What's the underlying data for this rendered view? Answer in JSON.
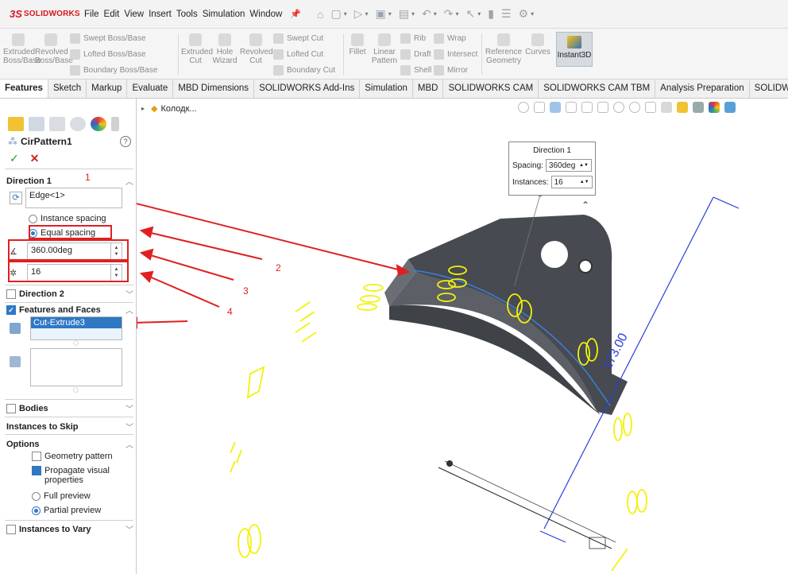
{
  "app": {
    "logo_mark": "3S",
    "logo_text": "SOLIDWORKS"
  },
  "menu": [
    "File",
    "Edit",
    "View",
    "Insert",
    "Tools",
    "Simulation",
    "Window"
  ],
  "ribbon": {
    "extruded_boss": "Extruded\nBoss/Base",
    "revolved_boss": "Revolved\nBoss/Base",
    "swept_boss": "Swept Boss/Base",
    "lofted_boss": "Lofted Boss/Base",
    "boundary_boss": "Boundary Boss/Base",
    "extruded_cut": "Extruded\nCut",
    "hole_wizard": "Hole\nWizard",
    "revolved_cut": "Revolved\nCut",
    "swept_cut": "Swept Cut",
    "lofted_cut": "Lofted Cut",
    "boundary_cut": "Boundary Cut",
    "fillet": "Fillet",
    "linear_pattern": "Linear\nPattern",
    "rib": "Rib",
    "draft": "Draft",
    "shell": "Shell",
    "wrap": "Wrap",
    "intersect": "Intersect",
    "mirror": "Mirror",
    "reference_geometry": "Reference\nGeometry",
    "curves": "Curves",
    "instant3d": "Instant3D"
  },
  "tabs": [
    "Features",
    "Sketch",
    "Markup",
    "Evaluate",
    "MBD Dimensions",
    "SOLIDWORKS Add-Ins",
    "Simulation",
    "MBD",
    "SOLIDWORKS CAM",
    "SOLIDWORKS CAM TBM",
    "Analysis Preparation",
    "SOLIDWORKS Inspecti"
  ],
  "panel": {
    "feature_name": "CirPattern1",
    "help": "?",
    "ok": "✓",
    "cancel": "✕",
    "direction1": {
      "title": "Direction 1",
      "axis_value": "Edge<1>",
      "instance_spacing": "Instance spacing",
      "equal_spacing": "Equal spacing",
      "angle": "360.00deg",
      "instances": "16"
    },
    "direction2": "Direction 2",
    "features_and_faces": {
      "title": "Features and Faces",
      "selected": "Cut-Extrude3"
    },
    "bodies": "Bodies",
    "instances_to_skip": "Instances to Skip",
    "options": {
      "title": "Options",
      "geometry_pattern": "Geometry pattern",
      "propagate_visual": "Propagate visual properties",
      "full_preview": "Full preview",
      "partial_preview": "Partial preview"
    },
    "instances_to_vary": "Instances to Vary"
  },
  "annotations": [
    "1",
    "2",
    "3",
    "4"
  ],
  "viewport": {
    "tree_item": "Колодк...",
    "callout": {
      "title": "Direction 1",
      "spacing_label": "Spacing:",
      "spacing_value": "360deg",
      "instances_label": "Instances:",
      "instances_value": "16"
    },
    "dimension_label": "173.00"
  },
  "colors": {
    "accent": "#2f78c4",
    "annotation_red": "#e02020",
    "preview_yellow": "#f2f20a",
    "part_dark": "#4a4c52",
    "axis_blue": "#2a3fd8"
  }
}
